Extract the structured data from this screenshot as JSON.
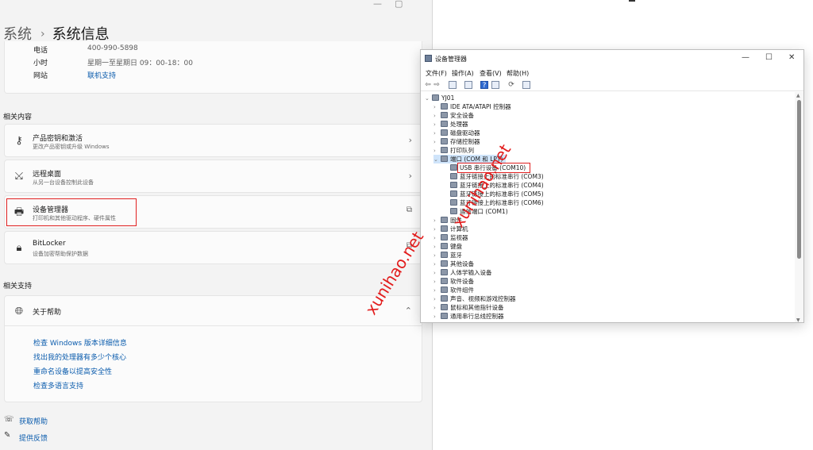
{
  "settings": {
    "breadcrumb": {
      "parent": "系统",
      "separator": "›",
      "current": "系统信息"
    },
    "window_controls": {
      "minimize": "—",
      "maximize": "▢"
    },
    "contact": {
      "phone_label": "电话",
      "phone_value": "400-990-5898",
      "hours_label": "小时",
      "hours_value": "星期一至星期日 09：00-18：00",
      "website_label": "网站",
      "website_value": "联机支持"
    },
    "related_content_title": "相关内容",
    "related": [
      {
        "title": "产品密钥和激活",
        "subtitle": "更改产品密钥或升级 Windows"
      },
      {
        "title": "远程桌面",
        "subtitle": "从另一台设备控制此设备"
      },
      {
        "title": "设备管理器",
        "subtitle": "打印机和其他驱动程序、硬件属性"
      },
      {
        "title": "BitLocker",
        "subtitle": "设备加密帮助保护数据"
      }
    ],
    "related_support_title": "相关支持",
    "help": {
      "title": "关于帮助",
      "links": [
        "检查 Windows 版本详细信息",
        "找出我的处理器有多少个核心",
        "重命名设备以提高安全性",
        "检查多语言支持"
      ]
    },
    "footer": {
      "get_help": "获取帮助",
      "feedback": "提供反馈"
    }
  },
  "device_manager": {
    "title": "设备管理器",
    "window_controls": {
      "minimize": "—",
      "maximize": "☐",
      "close": "✕"
    },
    "menu": [
      "文件(F)",
      "操作(A)",
      "查看(V)",
      "帮助(H)"
    ],
    "tree": {
      "root": "YJ01",
      "items": [
        "IDE ATA/ATAPI 控制器",
        "安全设备",
        "处理器",
        "磁盘驱动器",
        "存储控制器",
        "打印队列",
        "端口 (COM 和 LPT)",
        "USB 串行设备 (COM10)",
        "蓝牙链接上的标准串行 (COM3)",
        "蓝牙链接上的标准串行 (COM4)",
        "蓝牙链接上的标准串行 (COM5)",
        "蓝牙链接上的标准串行 (COM6)",
        "通信端口 (COM1)",
        "固件",
        "计算机",
        "监视器",
        "键盘",
        "蓝牙",
        "其他设备",
        "人体学输入设备",
        "软件设备",
        "软件组件",
        "声音、视频和游戏控制器",
        "鼠标和其他指针设备",
        "通用串行总线控制器"
      ]
    }
  },
  "watermark": "xunihao.net",
  "colors": {
    "highlight": "#e02020",
    "link": "#0b5cad",
    "selection": "#cfe4fa"
  }
}
